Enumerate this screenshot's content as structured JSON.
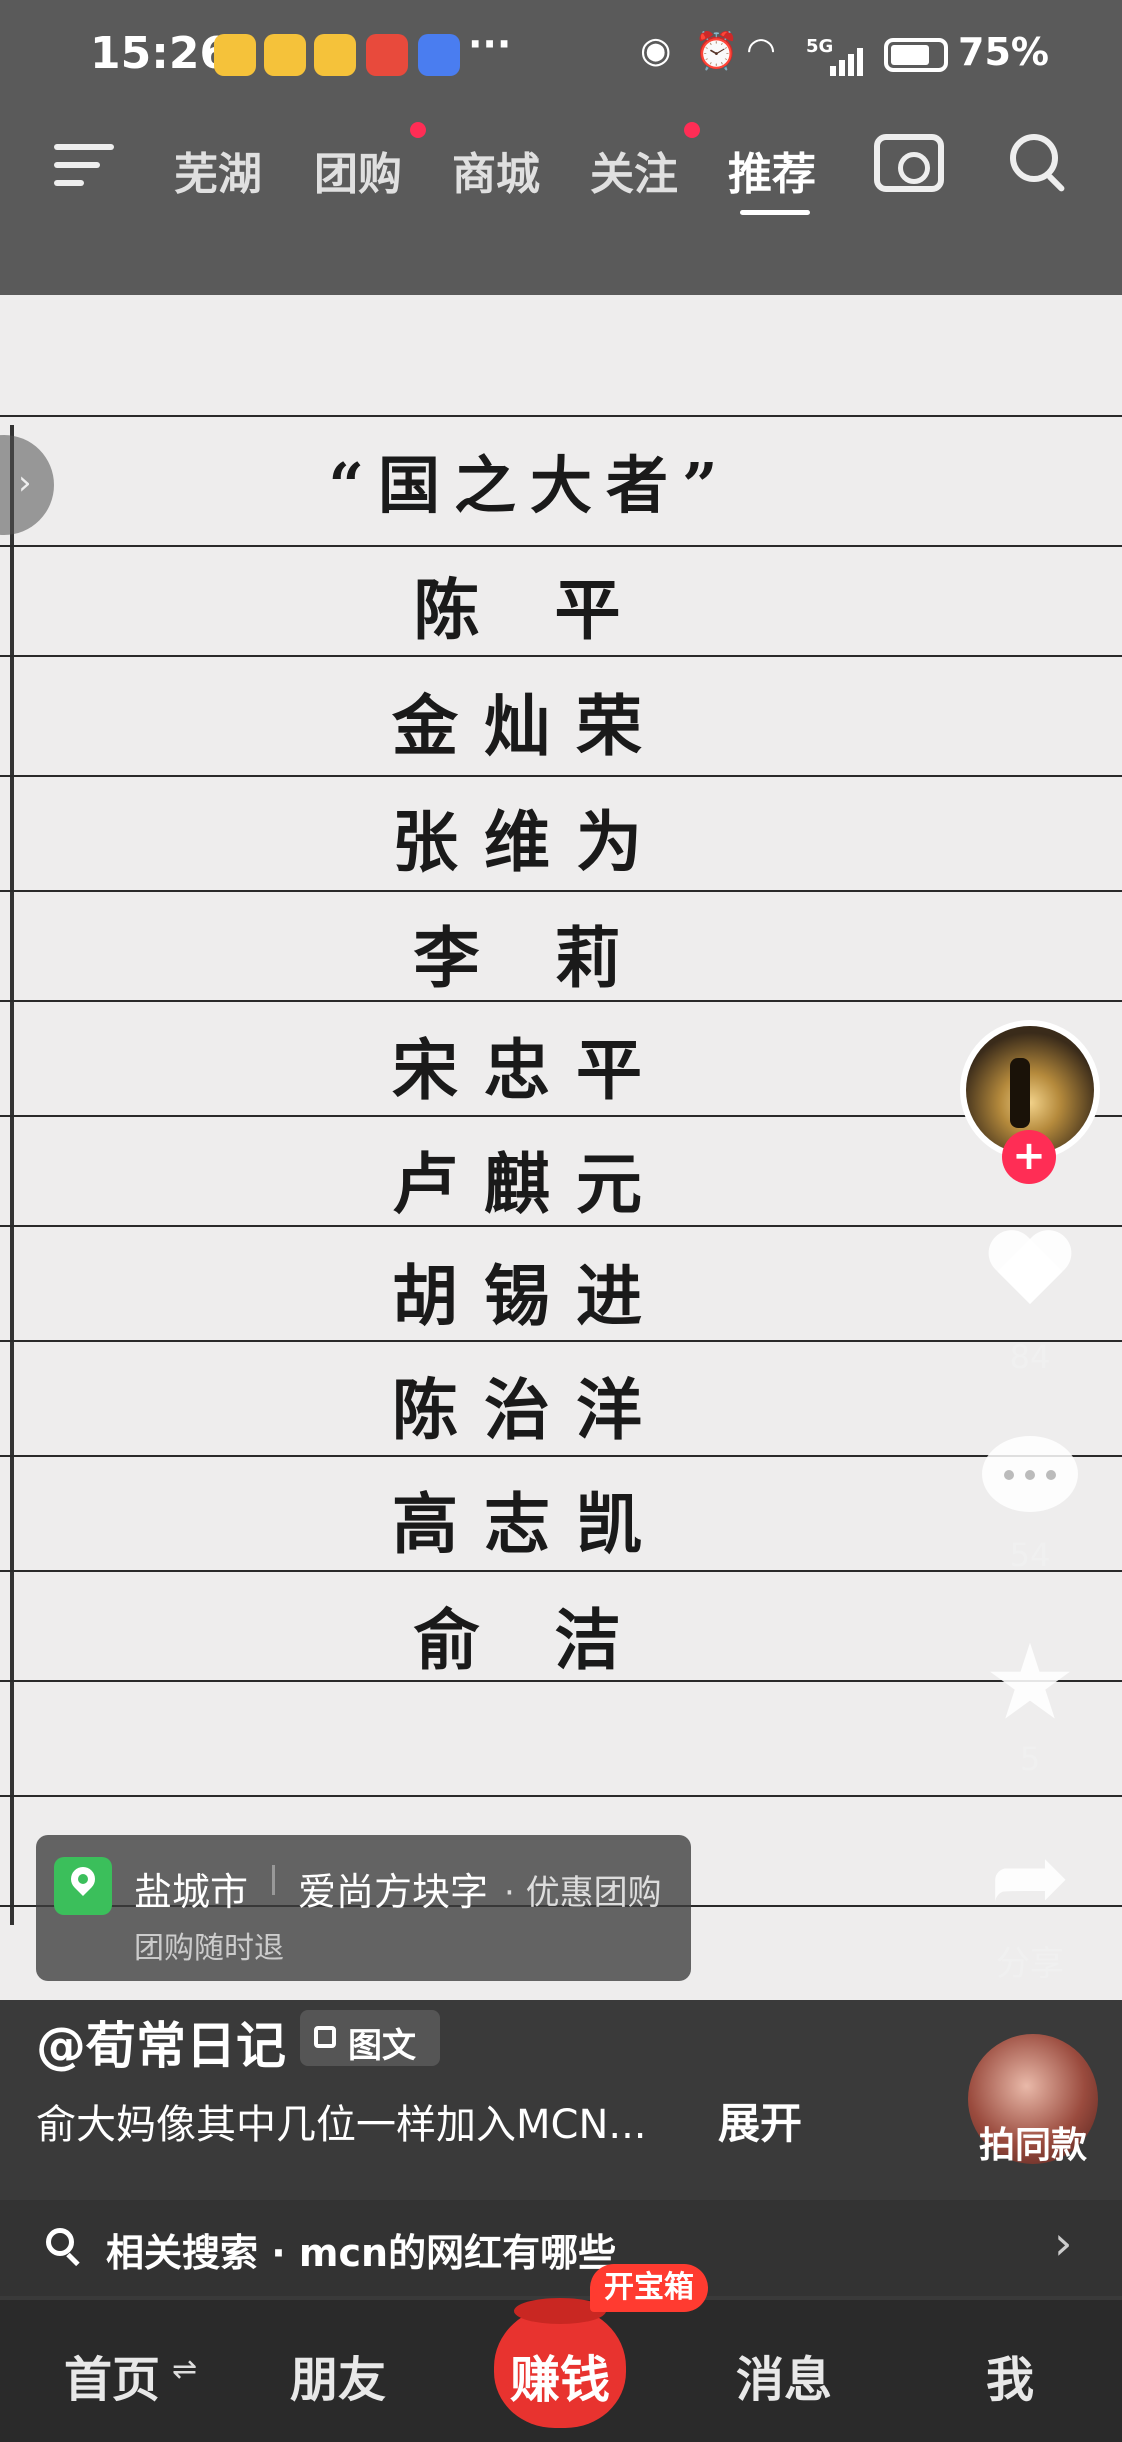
{
  "status_bar": {
    "time": "15:26",
    "dots": "···",
    "battery": "75%",
    "network": "5G"
  },
  "top_nav": {
    "tabs": [
      "芜湖",
      "团购",
      "商城",
      "关注",
      "推荐"
    ],
    "active": "推荐"
  },
  "notebook": {
    "title": "“国之大者”",
    "names": [
      "陈 平",
      "金灿荣",
      "张维为",
      "李 莉",
      "宋忠平",
      "卢麒元",
      "胡锡进",
      "陈治洋",
      "高志凯",
      "俞 洁"
    ]
  },
  "actions": {
    "like_count": "84",
    "comment_count": "54",
    "star_count": "5",
    "share_label": "分享"
  },
  "location": {
    "city": "盐城市",
    "shop": "爱尚方块字",
    "promo": "· 优惠团购",
    "sub": "团购随时退"
  },
  "post": {
    "author": "@荀常日记",
    "tag": "图文",
    "caption": "俞大妈像其中几位一样加入MCN...",
    "expand": "展开",
    "same_label": "拍同款"
  },
  "related_search": {
    "text": "相关搜索 · mcn的网红有哪些"
  },
  "bottom_nav": {
    "home": "首页",
    "friends": "朋友",
    "earn": "赚钱",
    "treasure": "开宝箱",
    "messages": "消息",
    "me": "我"
  },
  "colors": {
    "accent_red": "#ff2d55",
    "location_green": "#3bbf5b"
  }
}
